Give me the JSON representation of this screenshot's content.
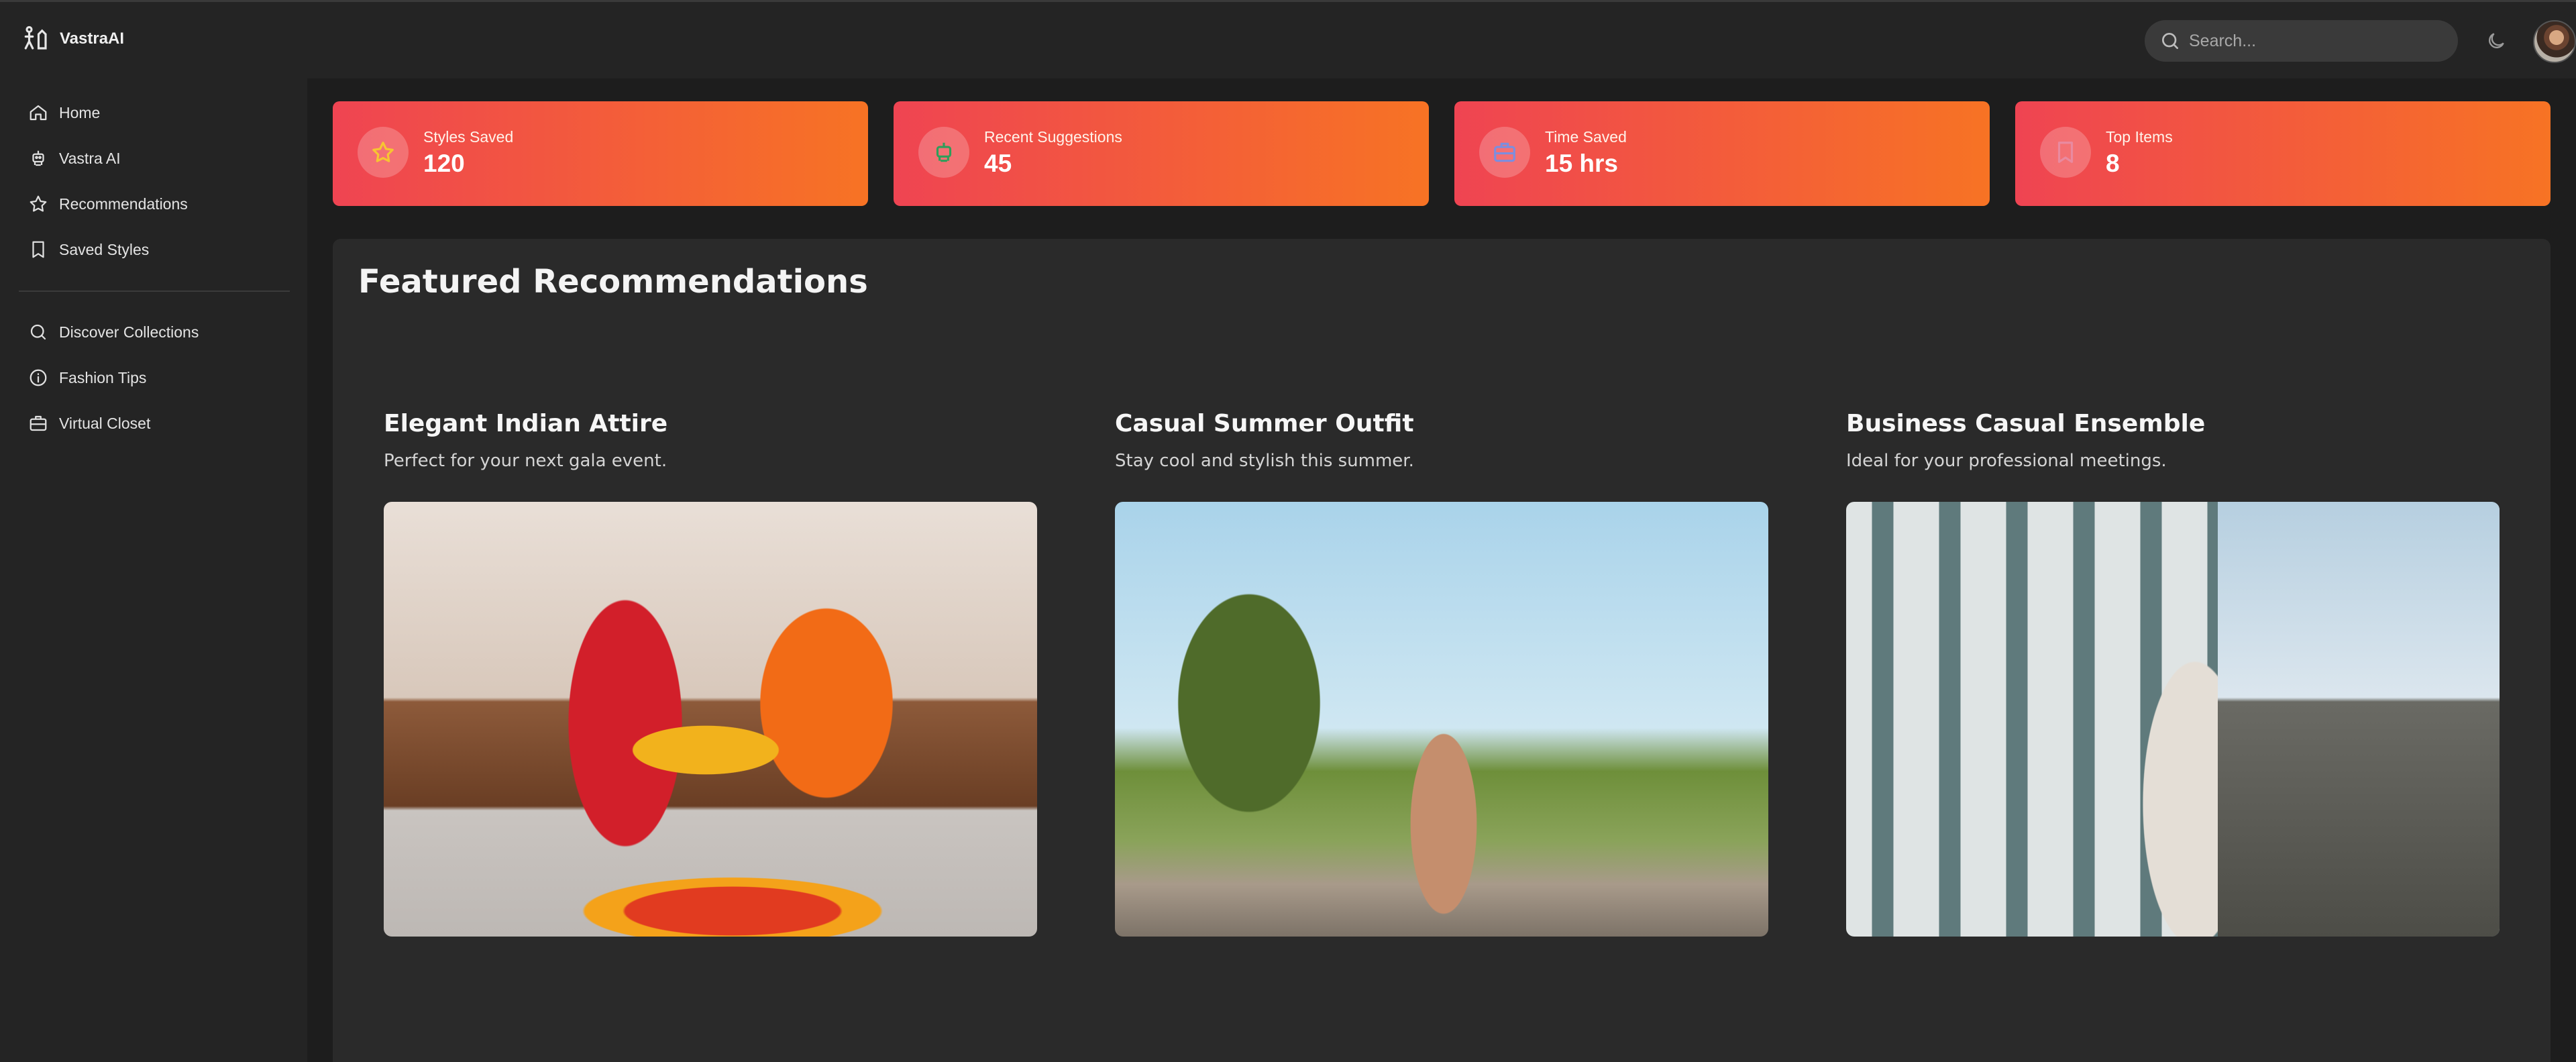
{
  "app": {
    "name": "VastraAI"
  },
  "search": {
    "placeholder": "Search..."
  },
  "sidebar": {
    "primary": [
      {
        "label": "Home",
        "icon": "home-icon"
      },
      {
        "label": "Vastra AI",
        "icon": "robot-icon"
      },
      {
        "label": "Recommendations",
        "icon": "star-icon"
      },
      {
        "label": "Saved Styles",
        "icon": "bookmark-icon"
      }
    ],
    "secondary": [
      {
        "label": "Discover Collections",
        "icon": "search-icon"
      },
      {
        "label": "Fashion Tips",
        "icon": "info-icon"
      },
      {
        "label": "Virtual Closet",
        "icon": "briefcase-icon"
      }
    ]
  },
  "stats": [
    {
      "label": "Styles Saved",
      "value": "120",
      "icon": "star-icon",
      "icon_color": "#f7c531"
    },
    {
      "label": "Recent Suggestions",
      "value": "45",
      "icon": "robot-icon",
      "icon_color": "#2e9e5a"
    },
    {
      "label": "Time Saved",
      "value": "15 hrs",
      "icon": "briefcase-icon",
      "icon_color": "#7b8ee0"
    },
    {
      "label": "Top Items",
      "value": "8",
      "icon": "bookmark-icon",
      "icon_color": "#e98aa0"
    }
  ],
  "featured": {
    "title": "Featured Recommendations",
    "items": [
      {
        "title": "Elegant Indian Attire",
        "description": "Perfect for your next gala event.",
        "image": "indian-attire-photo"
      },
      {
        "title": "Casual Summer Outfit",
        "description": "Stay cool and stylish this summer.",
        "image": "summer-outfit-photo"
      },
      {
        "title": "Business Casual Ensemble",
        "description": "Ideal for your professional meetings.",
        "image": "business-casual-photo"
      }
    ]
  },
  "colors": {
    "card_gradient_start": "#ef4452",
    "card_gradient_end": "#f77324",
    "background": "#1d1d1d",
    "panel": "#2a2a2a"
  }
}
